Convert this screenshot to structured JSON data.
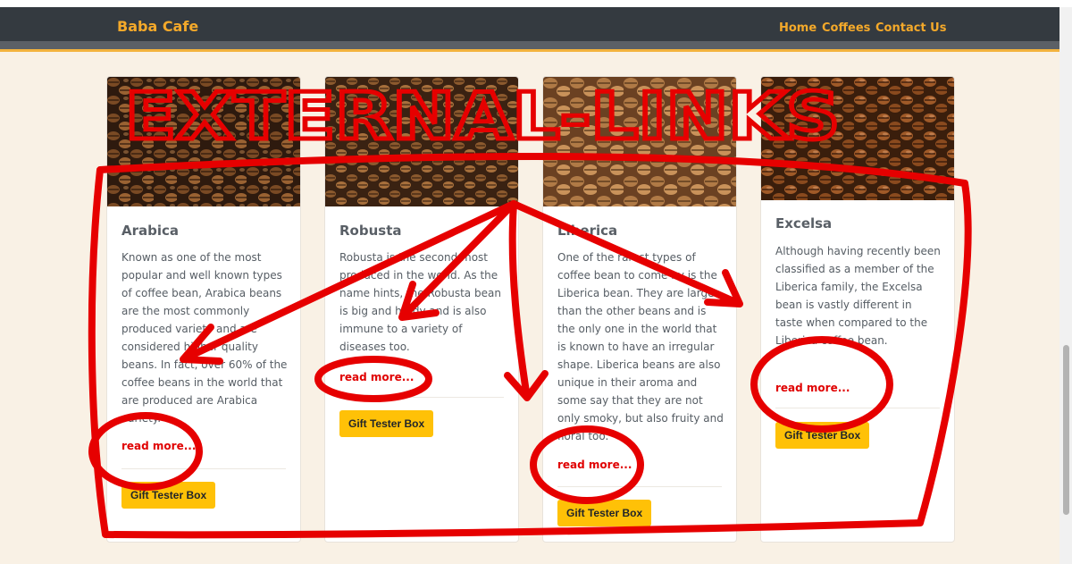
{
  "navbar": {
    "brand": "Baba Cafe",
    "links": [
      "Home",
      "Coffees",
      "Contact Us"
    ]
  },
  "cards": [
    {
      "title": "Arabica",
      "text": "Known as one of the most popular and well known types of coffee bean, Arabica beans are the most commonly produced variety and are considered higher quality beans. In fact, over 60% of the coffee beans in the world that are produced are Arabica variety.",
      "read_more": "read more...",
      "button": "Gift Tester Box"
    },
    {
      "title": "Robusta",
      "text": "Robusta is the second most produced in the world. As the name hints, the Robusta bean is big and hardy and is also immune to a variety of diseases too.",
      "read_more": "read more...",
      "button": "Gift Tester Box"
    },
    {
      "title": "Liberica",
      "text": "One of the rarest types of coffee bean to come by is the Liberica bean. They are larger than the other beans and is the only one in the world that is known to have an irregular shape. Liberica beans are also unique in their aroma and some say that they are not only smoky, but also fruity and floral too.",
      "read_more": "read more...",
      "button": "Gift Tester Box"
    },
    {
      "title": "Excelsa",
      "text": "Although having recently been classified as a member of the Liberica family, the Excelsa bean is vastly different in taste when compared to the Liberica coffee bean.",
      "read_more": "read more...",
      "button": "Gift Tester Box"
    }
  ],
  "annotation": {
    "label": "EXTERNAL-LINKS",
    "color": "#e60000"
  }
}
